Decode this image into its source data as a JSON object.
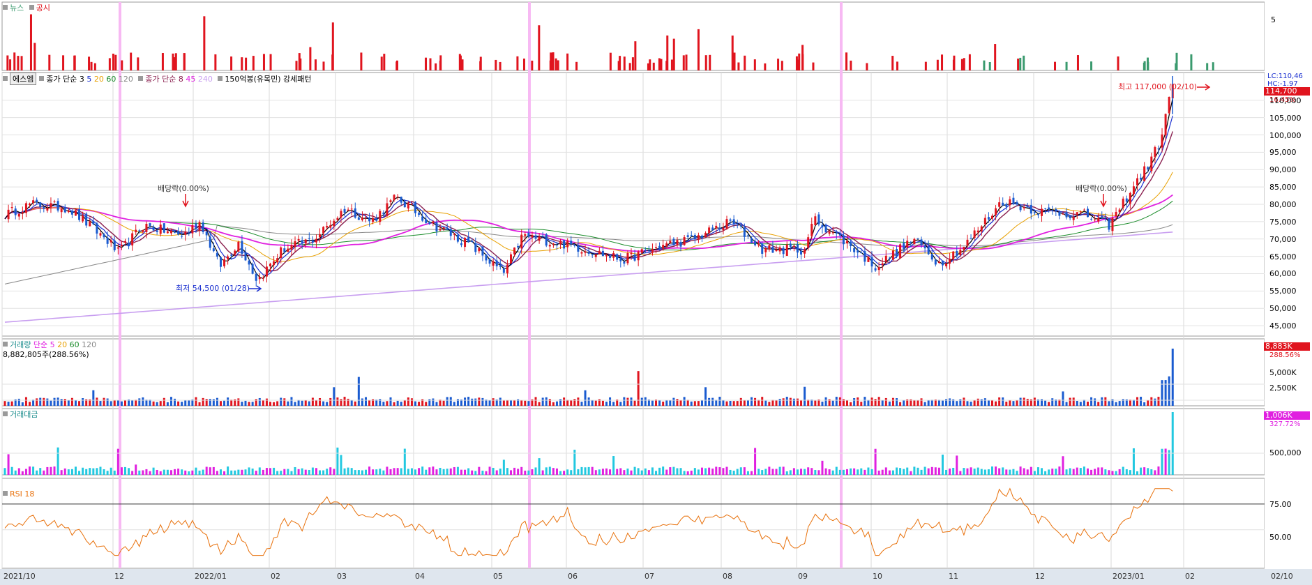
{
  "news_panel": {
    "legend_news": "뉴스",
    "legend_disclosure": "공시",
    "y_tick": "5",
    "news_color": "#3a9a6e",
    "disclosure_color": "#e0141e"
  },
  "price_panel": {
    "tab_label": "에스엠",
    "ma_short_label": "종가 단순",
    "ma_short_periods": [
      "3",
      "5",
      "20",
      "60",
      "120"
    ],
    "ma_long_label": "종가 단순",
    "ma_long_periods": [
      "8",
      "45",
      "240"
    ],
    "pattern_label": "150억봉(유목민) 강세패턴",
    "high_note": "최고 117,000 (02/10)",
    "low_note": "최저 54,500 (01/28)",
    "dividend_note_1": "배당락(0.00%)",
    "dividend_note_2": "배당락(0.00%)",
    "lc_label": "LC:110,46",
    "hc_label": "HC:-1.97",
    "current_price": "114,700",
    "current_change": "16.45%",
    "y_ticks": [
      "110,000",
      "105,000",
      "100,000",
      "95,000",
      "90,000",
      "85,000",
      "80,000",
      "75,000",
      "70,000",
      "65,000",
      "60,000",
      "55,000",
      "50,000",
      "45,000"
    ]
  },
  "volume_panel": {
    "label": "거래량",
    "ma_label": "단순",
    "ma_periods": [
      "5",
      "20",
      "60",
      "120"
    ],
    "last_volume": "8,882,805주(288.56%)",
    "tag_value": "8,883K",
    "tag_pct": "288.56%",
    "y_ticks": [
      "5,000K",
      "2,500K"
    ]
  },
  "amount_panel": {
    "label": "거래대금",
    "tag_value": "1,006K",
    "tag_pct": "327.72%",
    "y_ticks": [
      "500,000"
    ]
  },
  "rsi_panel": {
    "label": "RSI 18",
    "y_ticks": [
      "75.00",
      "50.00"
    ]
  },
  "x_axis": {
    "labels": [
      "2021/10",
      "12",
      "2022/01",
      "02",
      "03",
      "04",
      "05",
      "06",
      "07",
      "08",
      "09",
      "10",
      "11",
      "12",
      "2023/01",
      "02"
    ],
    "right_label": "02/10"
  },
  "chart_data": {
    "type": "candlestick",
    "title": "에스엠",
    "x_range": [
      "2021/10",
      "2023/02/10"
    ],
    "price_ylim": [
      42000,
      118000
    ],
    "price_high": {
      "value": 117000,
      "date": "02/10"
    },
    "price_low": {
      "value": 54500,
      "date": "01/28"
    },
    "last_close": 114700,
    "last_change_pct": 16.45,
    "price_path_points": [
      {
        "t": 0.0,
        "close": 77000
      },
      {
        "t": 0.02,
        "close": 80000
      },
      {
        "t": 0.05,
        "close": 79000
      },
      {
        "t": 0.08,
        "close": 70000
      },
      {
        "t": 0.09,
        "close": 66000
      },
      {
        "t": 0.11,
        "close": 74000
      },
      {
        "t": 0.14,
        "close": 71000
      },
      {
        "t": 0.155,
        "close": 75000
      },
      {
        "t": 0.17,
        "close": 62000
      },
      {
        "t": 0.185,
        "close": 69000
      },
      {
        "t": 0.2,
        "close": 58000
      },
      {
        "t": 0.22,
        "close": 67000
      },
      {
        "t": 0.245,
        "close": 70000
      },
      {
        "t": 0.27,
        "close": 79000
      },
      {
        "t": 0.29,
        "close": 75000
      },
      {
        "t": 0.31,
        "close": 82000
      },
      {
        "t": 0.34,
        "close": 74000
      },
      {
        "t": 0.37,
        "close": 68000
      },
      {
        "t": 0.395,
        "close": 60000
      },
      {
        "t": 0.41,
        "close": 71000
      },
      {
        "t": 0.45,
        "close": 68000
      },
      {
        "t": 0.49,
        "close": 64000
      },
      {
        "t": 0.52,
        "close": 68000
      },
      {
        "t": 0.545,
        "close": 70000
      },
      {
        "t": 0.575,
        "close": 75000
      },
      {
        "t": 0.6,
        "close": 67000
      },
      {
        "t": 0.635,
        "close": 67000
      },
      {
        "t": 0.64,
        "close": 76000
      },
      {
        "t": 0.67,
        "close": 68000
      },
      {
        "t": 0.69,
        "close": 62000
      },
      {
        "t": 0.72,
        "close": 70000
      },
      {
        "t": 0.74,
        "close": 63000
      },
      {
        "t": 0.76,
        "close": 68000
      },
      {
        "t": 0.79,
        "close": 81000
      },
      {
        "t": 0.82,
        "close": 78000
      },
      {
        "t": 0.855,
        "close": 77000
      },
      {
        "t": 0.875,
        "close": 74000
      },
      {
        "t": 0.89,
        "close": 83000
      },
      {
        "t": 0.905,
        "close": 91000
      },
      {
        "t": 0.915,
        "close": 98000
      },
      {
        "t": 0.925,
        "close": 114700
      }
    ],
    "volume_last": 8882805,
    "volume_change_pct": 288.56,
    "rsi_period": 18,
    "rsi_last": 80
  }
}
